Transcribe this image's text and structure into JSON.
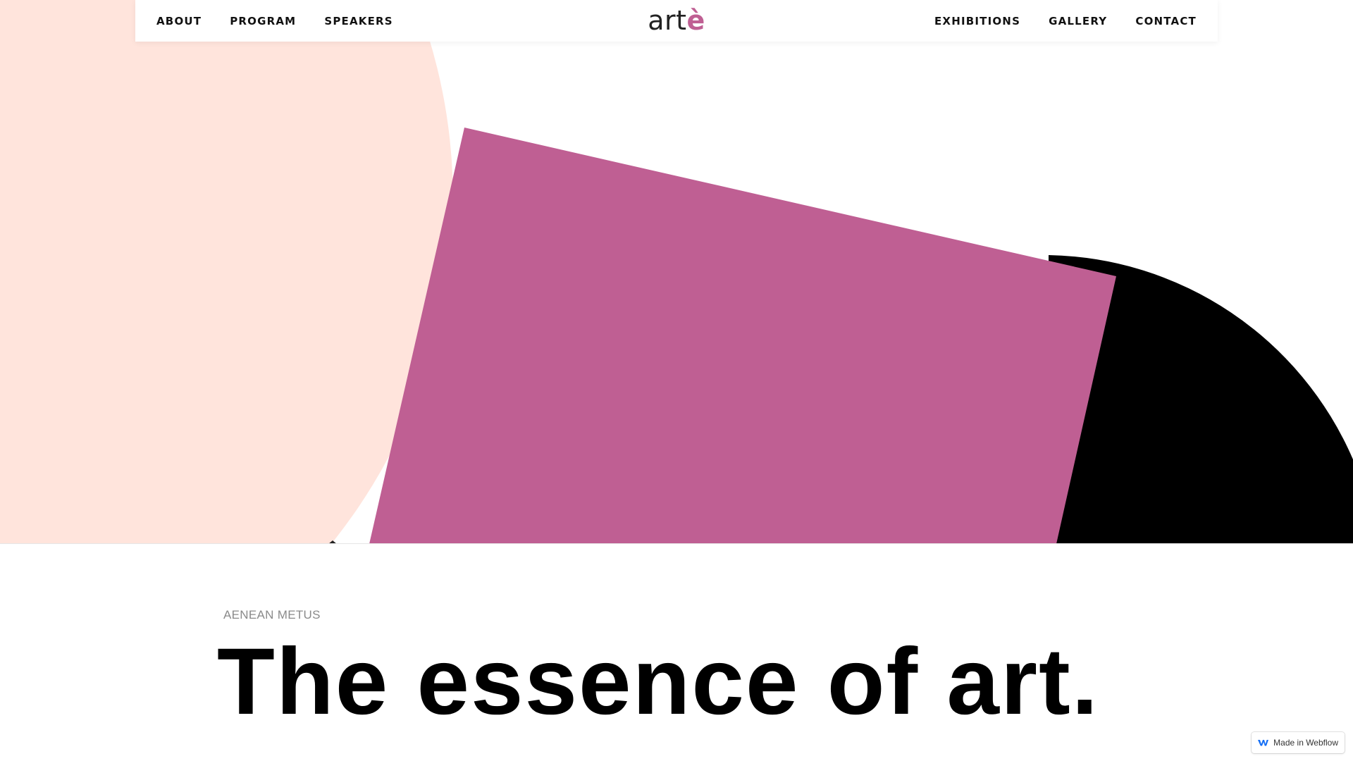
{
  "nav": {
    "left_links": [
      "ABOUT",
      "PROGRAM",
      "SPEAKERS"
    ],
    "right_links": [
      "EXHIBITIONS",
      "GALLERY",
      "CONTACT"
    ],
    "logo_text": "art",
    "logo_accent": "è"
  },
  "hero": {
    "colors": {
      "peach": "#ffe4dc",
      "magenta": "#bf5f93",
      "black": "#000000"
    }
  },
  "content": {
    "eyebrow": "AENEAN METUS",
    "headline": "The essence of art."
  },
  "badge": {
    "label": "Made in Webflow"
  }
}
